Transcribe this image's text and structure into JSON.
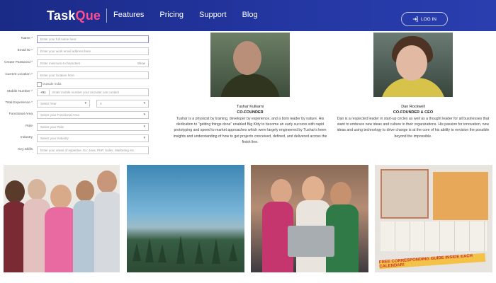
{
  "header": {
    "logo_main": "Task",
    "logo_accent": "Que",
    "nav": [
      "Features",
      "Pricing",
      "Support",
      "Blog"
    ],
    "login_label": "LOG IN"
  },
  "form": {
    "fields": [
      {
        "label": "Name *",
        "placeholder": "Enter your full name here"
      },
      {
        "label": "Email ID *",
        "placeholder": "Enter your work email address here"
      },
      {
        "label": "Create Password *",
        "placeholder": "Enter minimum 6 characters",
        "right": "Show"
      },
      {
        "label": "Current Location *",
        "placeholder": "Enter your location here"
      },
      {
        "checkbox": "Outside India"
      },
      {
        "label": "Mobile Number *",
        "prefix": "+91",
        "placeholder": "Enter mobile number your recruiter can contact"
      },
      {
        "label": "Total Experience *",
        "sel1": "Select Year",
        "sel2": "0"
      },
      {
        "label": "Functional Area",
        "placeholder": "Select your Functional Area"
      },
      {
        "label": "Role",
        "placeholder": "Select your Role"
      },
      {
        "label": "Industry",
        "placeholder": "Select your Industry"
      },
      {
        "label": "Key Skills",
        "placeholder": "Enter your areas of expertise. Ex: Java, PHP, Sales, Marketing etc."
      }
    ]
  },
  "profiles": [
    {
      "name": "Tushar Kulkarni",
      "role": "CO-FOUNDER",
      "bio": "Tushar is a physicist by training, developer by experience, and a born leader by nature. His dedication to \"getting things done\" enabled Big Kitty to become an early success with rapid prototyping and speed to market approaches which were largely engineered by Tushar's keen insights and understanding of how to get projects conceived, defined, and delivered across the finish line."
    },
    {
      "name": "Dan Rockwell",
      "role": "CO-FOUNDER & CEO",
      "bio": "Dan is a respected leader in start-up circles as well as a thought leader for all businesses that want to embrace new ideas and culture in their organizations. His passion for innovation, new ideas and using technology to drive change is at the core of his ability to envision the possible beyond the impossible."
    }
  ],
  "gallery": {
    "banner": "FREE CORRESPONDING GUIDE INSIDE EACH CALENDAR!"
  }
}
